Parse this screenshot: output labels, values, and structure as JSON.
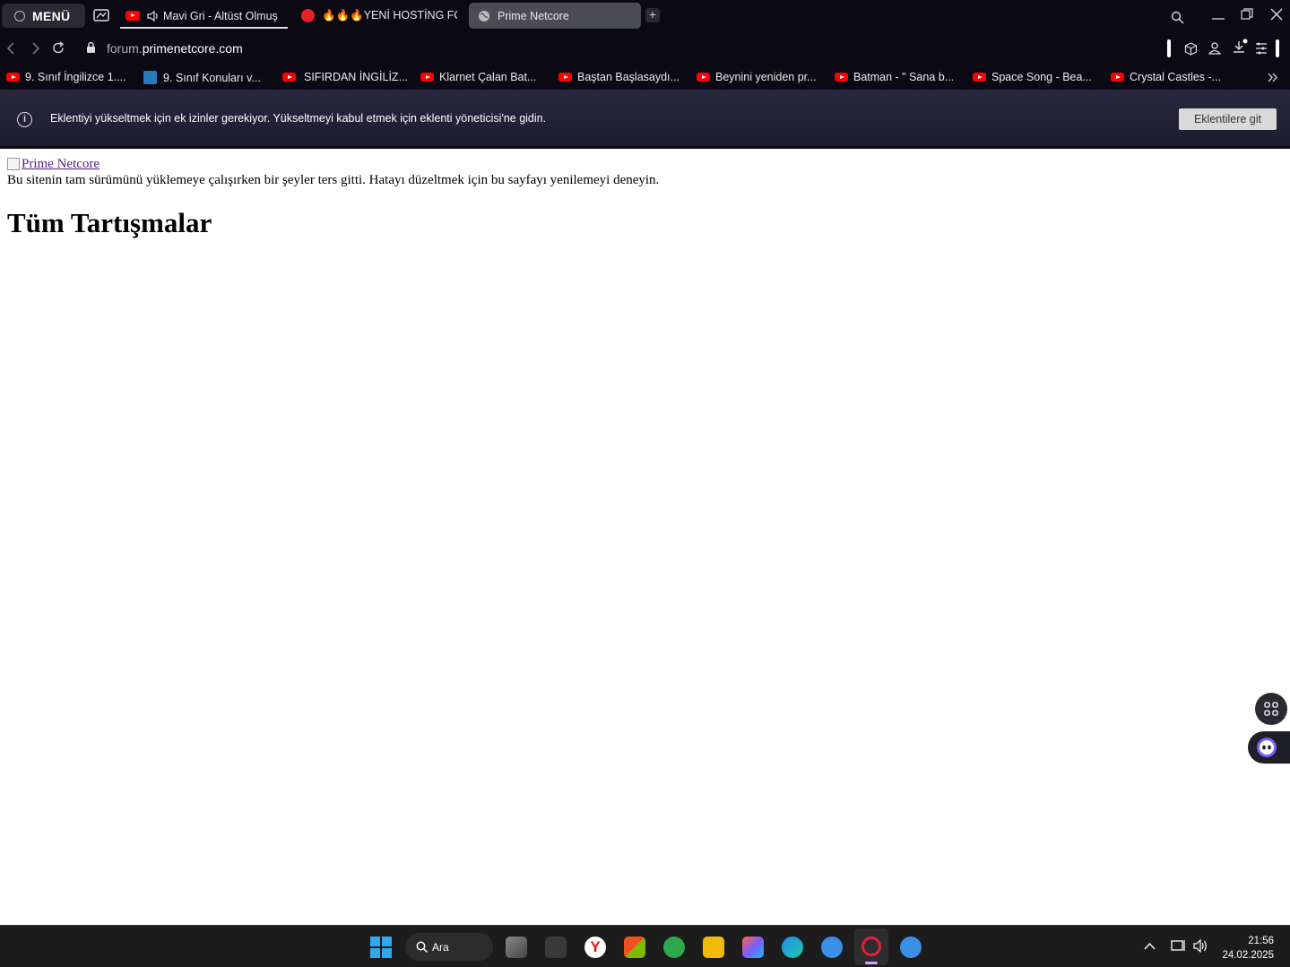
{
  "browser": {
    "menu_label": "MENÜ",
    "tabs": [
      {
        "title": "Mavi Gri - Altüst Olmuş",
        "icon": "youtube-icon",
        "audio": true
      },
      {
        "title": "🔥🔥🔥YENİ HOSTİNG FO",
        "icon": "tiktok-icon"
      },
      {
        "title": "Prime Netcore",
        "icon": "globe-icon",
        "selected": true
      }
    ],
    "url_sub": "forum.",
    "url_domain": "primenetcore.com",
    "bookmarks": [
      {
        "label": "9. Sınıf İngilizce 1....",
        "icon": "youtube-icon"
      },
      {
        "label": "9. Sınıf Konuları v...",
        "icon": "shield-icon"
      },
      {
        "label": "SIFIRDAN İNGİLİZ...",
        "icon": "youtube-icon"
      },
      {
        "label": "Klarnet Çalan Bat...",
        "icon": "youtube-icon"
      },
      {
        "label": "Baştan Başlasaydı...",
        "icon": "youtube-icon"
      },
      {
        "label": "Beynini yeniden pr...",
        "icon": "youtube-icon"
      },
      {
        "label": "Batman - \" Sana b...",
        "icon": "youtube-icon"
      },
      {
        "label": "Space Song - Bea...",
        "icon": "youtube-icon"
      },
      {
        "label": "Crystal Castles -...",
        "icon": "youtube-icon"
      }
    ],
    "infobar": {
      "message": "Eklentiyi yükseltmek için ek izinler gerekiyor. Yükseltmeyi kabul etmek için eklenti yöneticisi'ne gidin.",
      "button": "Eklentilere git"
    }
  },
  "page": {
    "logo_alt": "Prime Netcore",
    "error": "Bu sitenin tam sürümünü yüklemeye çalışırken bir şeyler ters gitti. Hatayı düzeltmek için bu sayfayı yenilemeyi deneyin.",
    "heading": "Tüm Tartışmalar"
  },
  "taskbar": {
    "search_label": "Ara",
    "time": "21:56",
    "date": "24.02.2025"
  },
  "colors": {
    "chrome_bg": "#0a0914",
    "infobar_bg": "#2a2840",
    "youtube_red": "#ff0000"
  }
}
